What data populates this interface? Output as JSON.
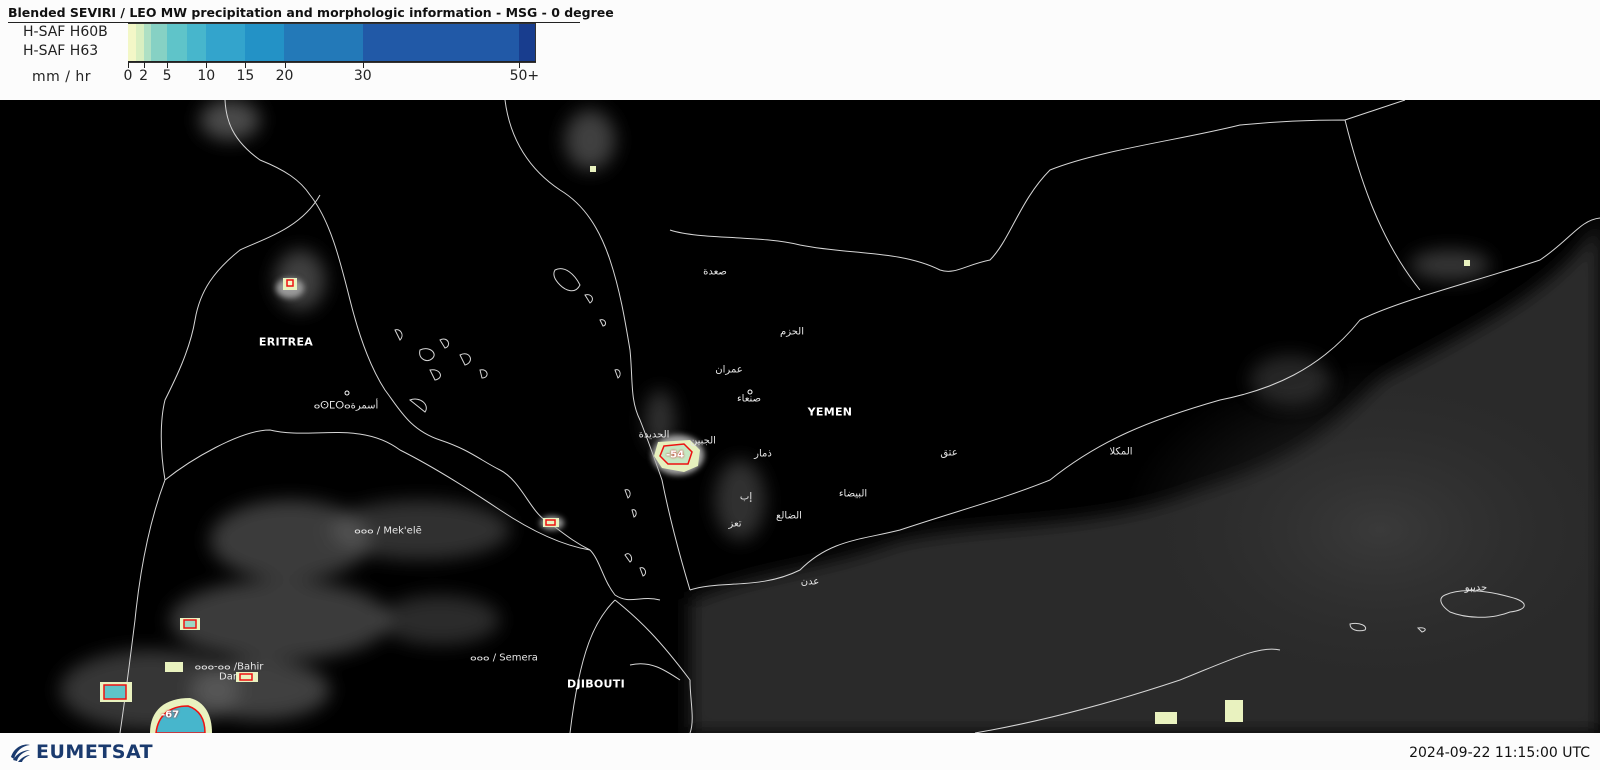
{
  "header": {
    "title": "Blended SEVIRI / LEO MW precipitation and morphologic information - MSG - 0 degree",
    "product_line_1": "H-SAF H60B",
    "product_line_2": "H-SAF H63",
    "unit": "mm / hr"
  },
  "legend": {
    "min": 0,
    "max": 52,
    "ticks": [
      {
        "value": 0,
        "label": "0"
      },
      {
        "value": 2,
        "label": "2"
      },
      {
        "value": 5,
        "label": "5"
      },
      {
        "value": 10,
        "label": "10"
      },
      {
        "value": 15,
        "label": "15"
      },
      {
        "value": 20,
        "label": "20"
      },
      {
        "value": 30,
        "label": "30"
      },
      {
        "value": 50,
        "label": "50+"
      }
    ],
    "bins": [
      {
        "from": 0,
        "to": 1,
        "color": "#f3f7c7"
      },
      {
        "from": 1,
        "to": 2,
        "color": "#d9efc1"
      },
      {
        "from": 2,
        "to": 3,
        "color": "#aee0c4"
      },
      {
        "from": 3,
        "to": 5,
        "color": "#86d1c4"
      },
      {
        "from": 5,
        "to": 7.5,
        "color": "#5fc4c9"
      },
      {
        "from": 7.5,
        "to": 10,
        "color": "#47b6cc"
      },
      {
        "from": 10,
        "to": 15,
        "color": "#33a4cc"
      },
      {
        "from": 15,
        "to": 20,
        "color": "#2392c6"
      },
      {
        "from": 20,
        "to": 30,
        "color": "#2379b8"
      },
      {
        "from": 30,
        "to": 50,
        "color": "#2159a7"
      },
      {
        "from": 50,
        "to": 52,
        "color": "#183d8e"
      }
    ]
  },
  "map": {
    "countries": [
      {
        "name": "ERITREA"
      },
      {
        "name": "YEMEN"
      },
      {
        "name": "DJIBOUTI"
      }
    ],
    "cities": [
      {
        "name": "صعدة"
      },
      {
        "name": "الحزم"
      },
      {
        "name": "عمران"
      },
      {
        "name": "صنعاء"
      },
      {
        "name": "الحديدة"
      },
      {
        "name": "الجبين"
      },
      {
        "name": "ذمار"
      },
      {
        "name": "عتق"
      },
      {
        "name": "المكلا"
      },
      {
        "name": "إب"
      },
      {
        "name": "البيضاء"
      },
      {
        "name": "الضالع"
      },
      {
        "name": "تعز"
      },
      {
        "name": "عدن"
      },
      {
        "name": "حديبو"
      },
      {
        "name": "ⴰⵙⵎⵔⴰأسمرة"
      },
      {
        "name": "ⴰⴰⴰ / Mek'elē"
      },
      {
        "name": "ⴰⴰⴰ / Semera"
      },
      {
        "name": "ⴰⴰⴰ-ⴰⴰ /Bahir"
      },
      {
        "name": "Dar"
      }
    ],
    "cloud_top_temps": [
      "-54",
      "-67"
    ]
  },
  "footer": {
    "logo_text": "EUMETSAT",
    "timestamp": "2024-09-22 11:15:00 UTC"
  }
}
